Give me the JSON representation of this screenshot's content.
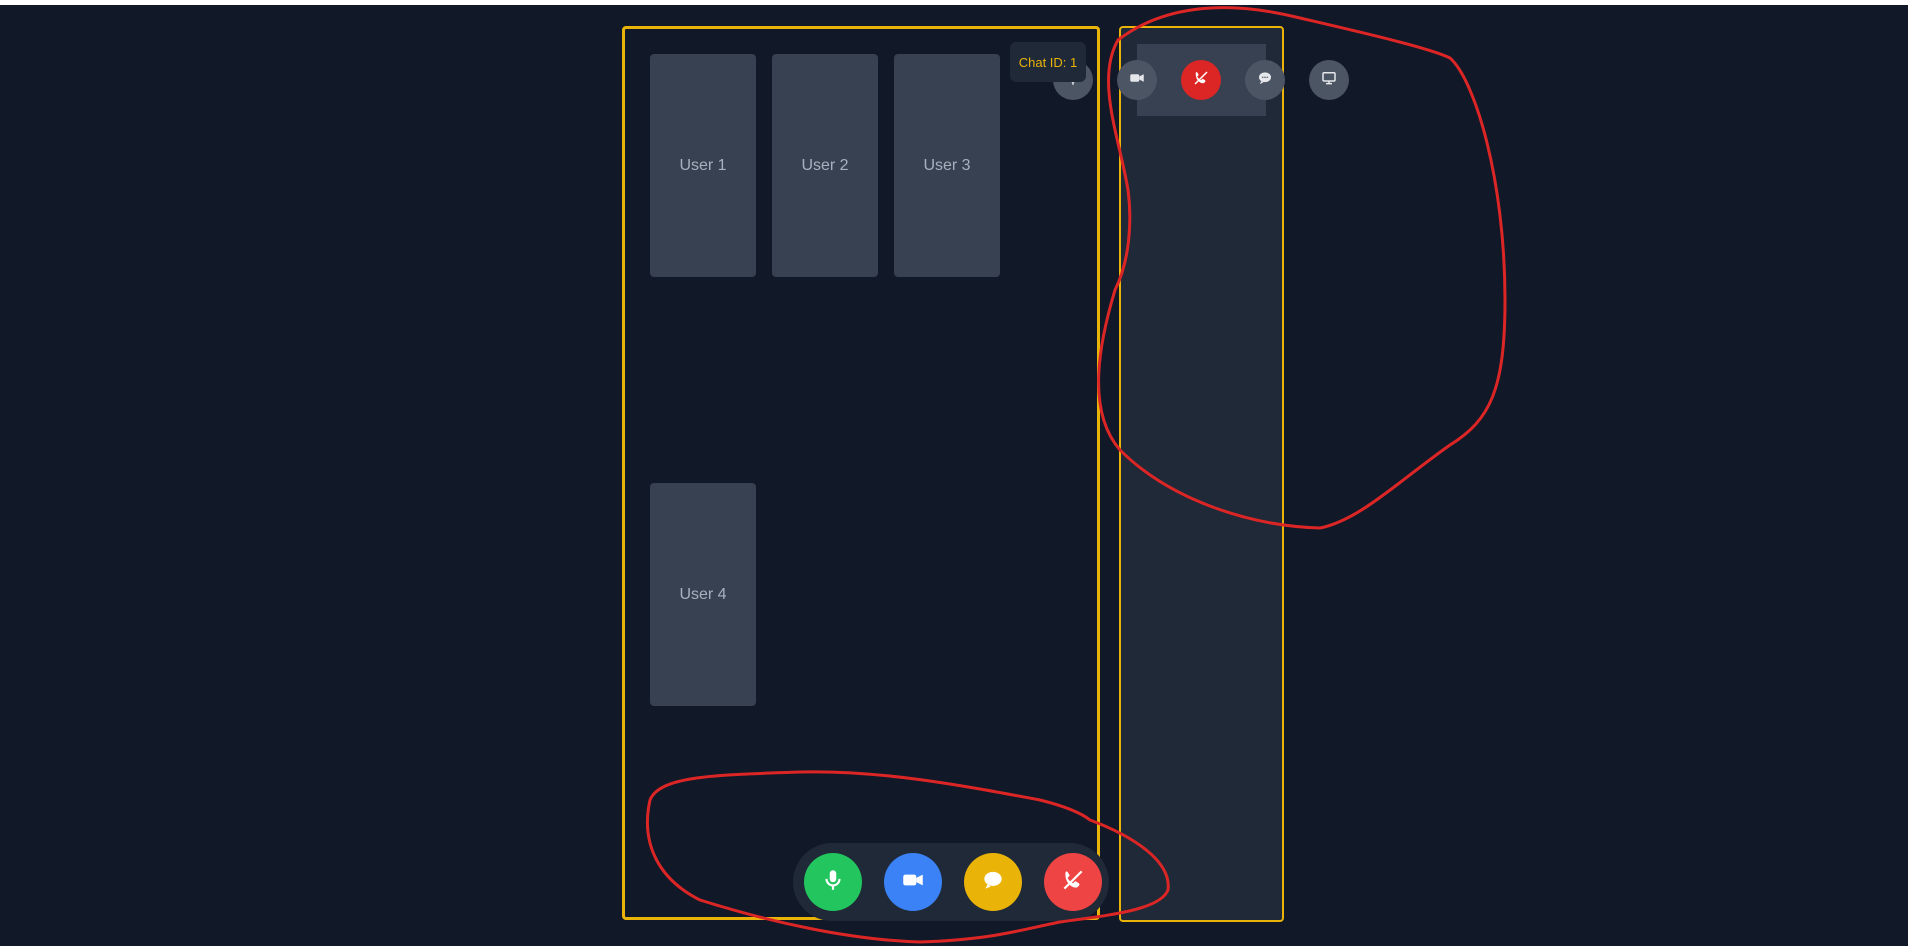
{
  "chat": {
    "id_label": "Chat ID: 1"
  },
  "participants": [
    {
      "label": "User 1"
    },
    {
      "label": "User 2"
    },
    {
      "label": "User 3"
    },
    {
      "label": "User 4"
    }
  ],
  "top_toolbar": {
    "icons": [
      "microphone-icon",
      "video-camera-icon",
      "end-call-icon",
      "chat-bubble-icon",
      "monitor-icon"
    ]
  },
  "bottom_controls": {
    "icons": [
      "microphone-icon",
      "video-camera-icon",
      "chat-bubble-icon",
      "end-call-icon"
    ]
  },
  "colors": {
    "background": "#111827",
    "accent_border": "#eab308",
    "tile": "#374151",
    "toolbar_button": "#4b5563",
    "mic_button": "#22c55e",
    "video_button": "#3b82f6",
    "chat_button": "#eab308",
    "end_call_button": "#ef4444",
    "annotation_stroke": "#dc2626"
  }
}
